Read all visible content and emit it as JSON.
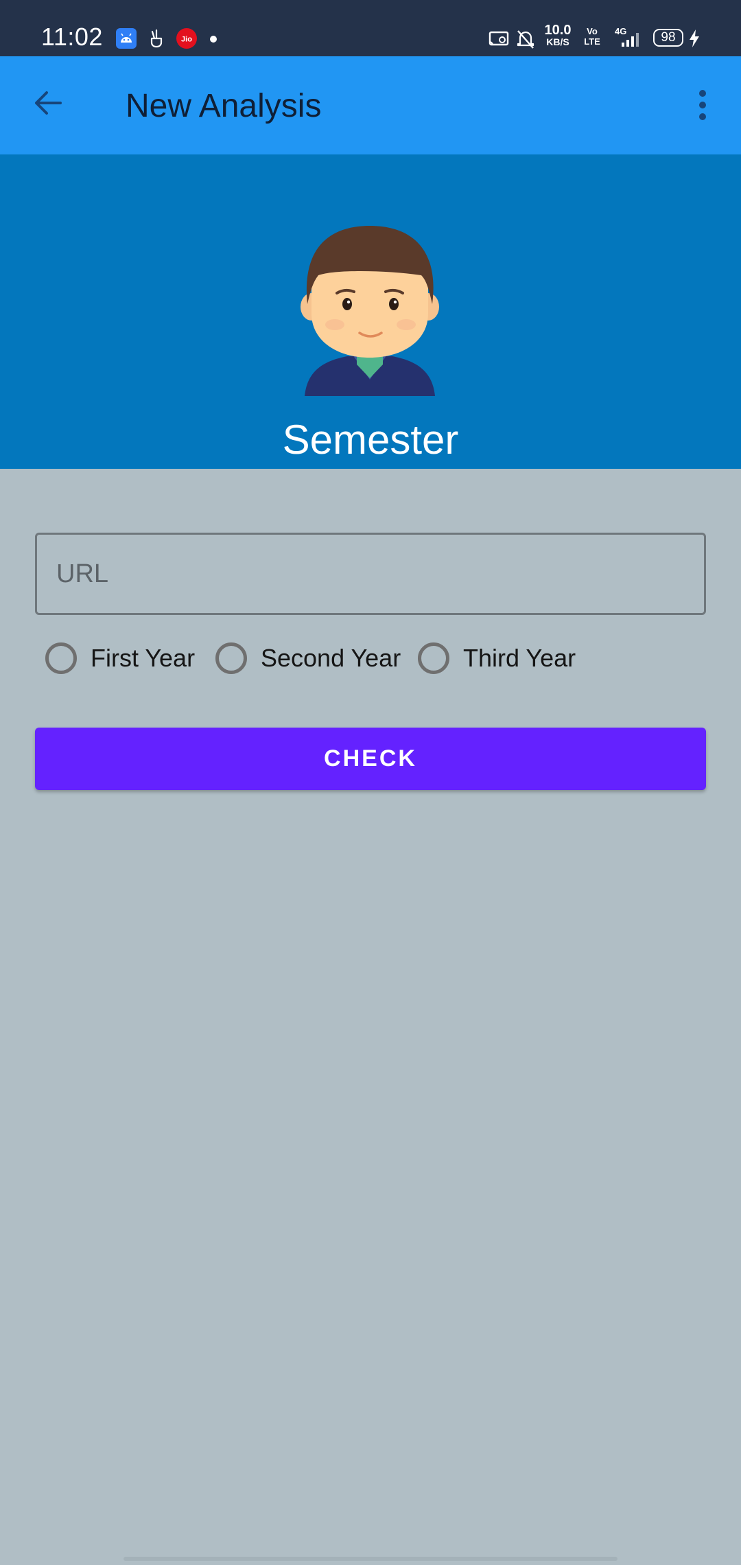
{
  "status_bar": {
    "time": "11:02",
    "net_speed_value": "10.0",
    "net_speed_unit": "KB/S",
    "volte_top": "Vo",
    "volte_bottom": "LTE",
    "network_type": "4G",
    "battery": "98",
    "notification_icons": [
      "android-app-icon",
      "peace-hand-icon",
      "jio-icon",
      "more-dot-icon"
    ],
    "jio_label": "Jio"
  },
  "app_bar": {
    "title": "New Analysis",
    "back_icon": "arrow-back-icon",
    "menu_icon": "more-vert-icon",
    "color": "#2196f3"
  },
  "header": {
    "title": "Semester",
    "color": "#0377bd"
  },
  "form": {
    "url_placeholder": "URL",
    "url_value": "",
    "year_options": [
      {
        "label": "First Year",
        "selected": false
      },
      {
        "label": "Second Year",
        "selected": false
      },
      {
        "label": "Third Year",
        "selected": false
      }
    ],
    "check_label": "CHECK",
    "button_color": "#6422ff"
  }
}
